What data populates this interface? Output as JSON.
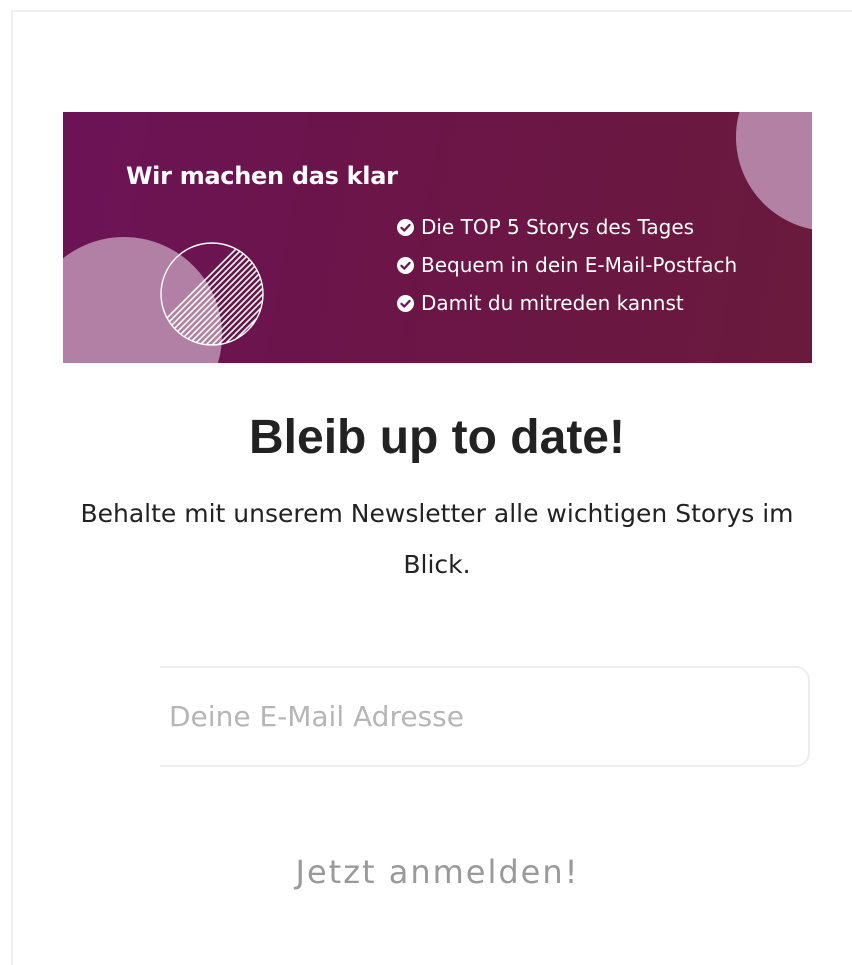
{
  "banner": {
    "heading": "Wir machen das klar",
    "benefits": [
      "Die TOP 5 Storys des Tages",
      "Bequem in dein E-Mail-Postfach",
      "Damit du mitreden kannst"
    ],
    "icon": "check-circle-icon",
    "colors": {
      "gradient_start": "#6c1357",
      "gradient_end": "#6a1a3c",
      "circle": "#b98aac"
    }
  },
  "newsletter": {
    "title": "Bleib up to date!",
    "subtitle": "Behalte mit unserem Newsletter alle wichtigen Storys im Blick.",
    "email_placeholder": "Deine E-Mail Adresse",
    "submit_label": "Jetzt anmelden!"
  }
}
